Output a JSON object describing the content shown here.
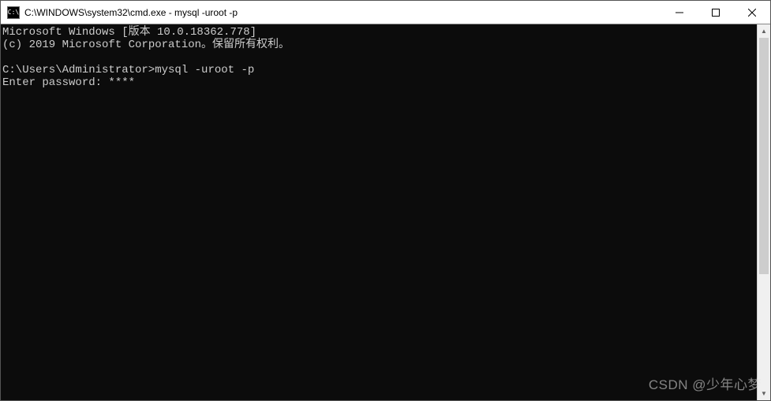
{
  "titlebar": {
    "icon_label": "C:\\",
    "title": "C:\\WINDOWS\\system32\\cmd.exe - mysql  -uroot -p"
  },
  "terminal": {
    "lines": [
      "Microsoft Windows [版本 10.0.18362.778]",
      "(c) 2019 Microsoft Corporation。保留所有权利。",
      "",
      "C:\\Users\\Administrator>mysql -uroot -p",
      "Enter password: ****"
    ]
  },
  "watermark": "CSDN @少年心梦"
}
